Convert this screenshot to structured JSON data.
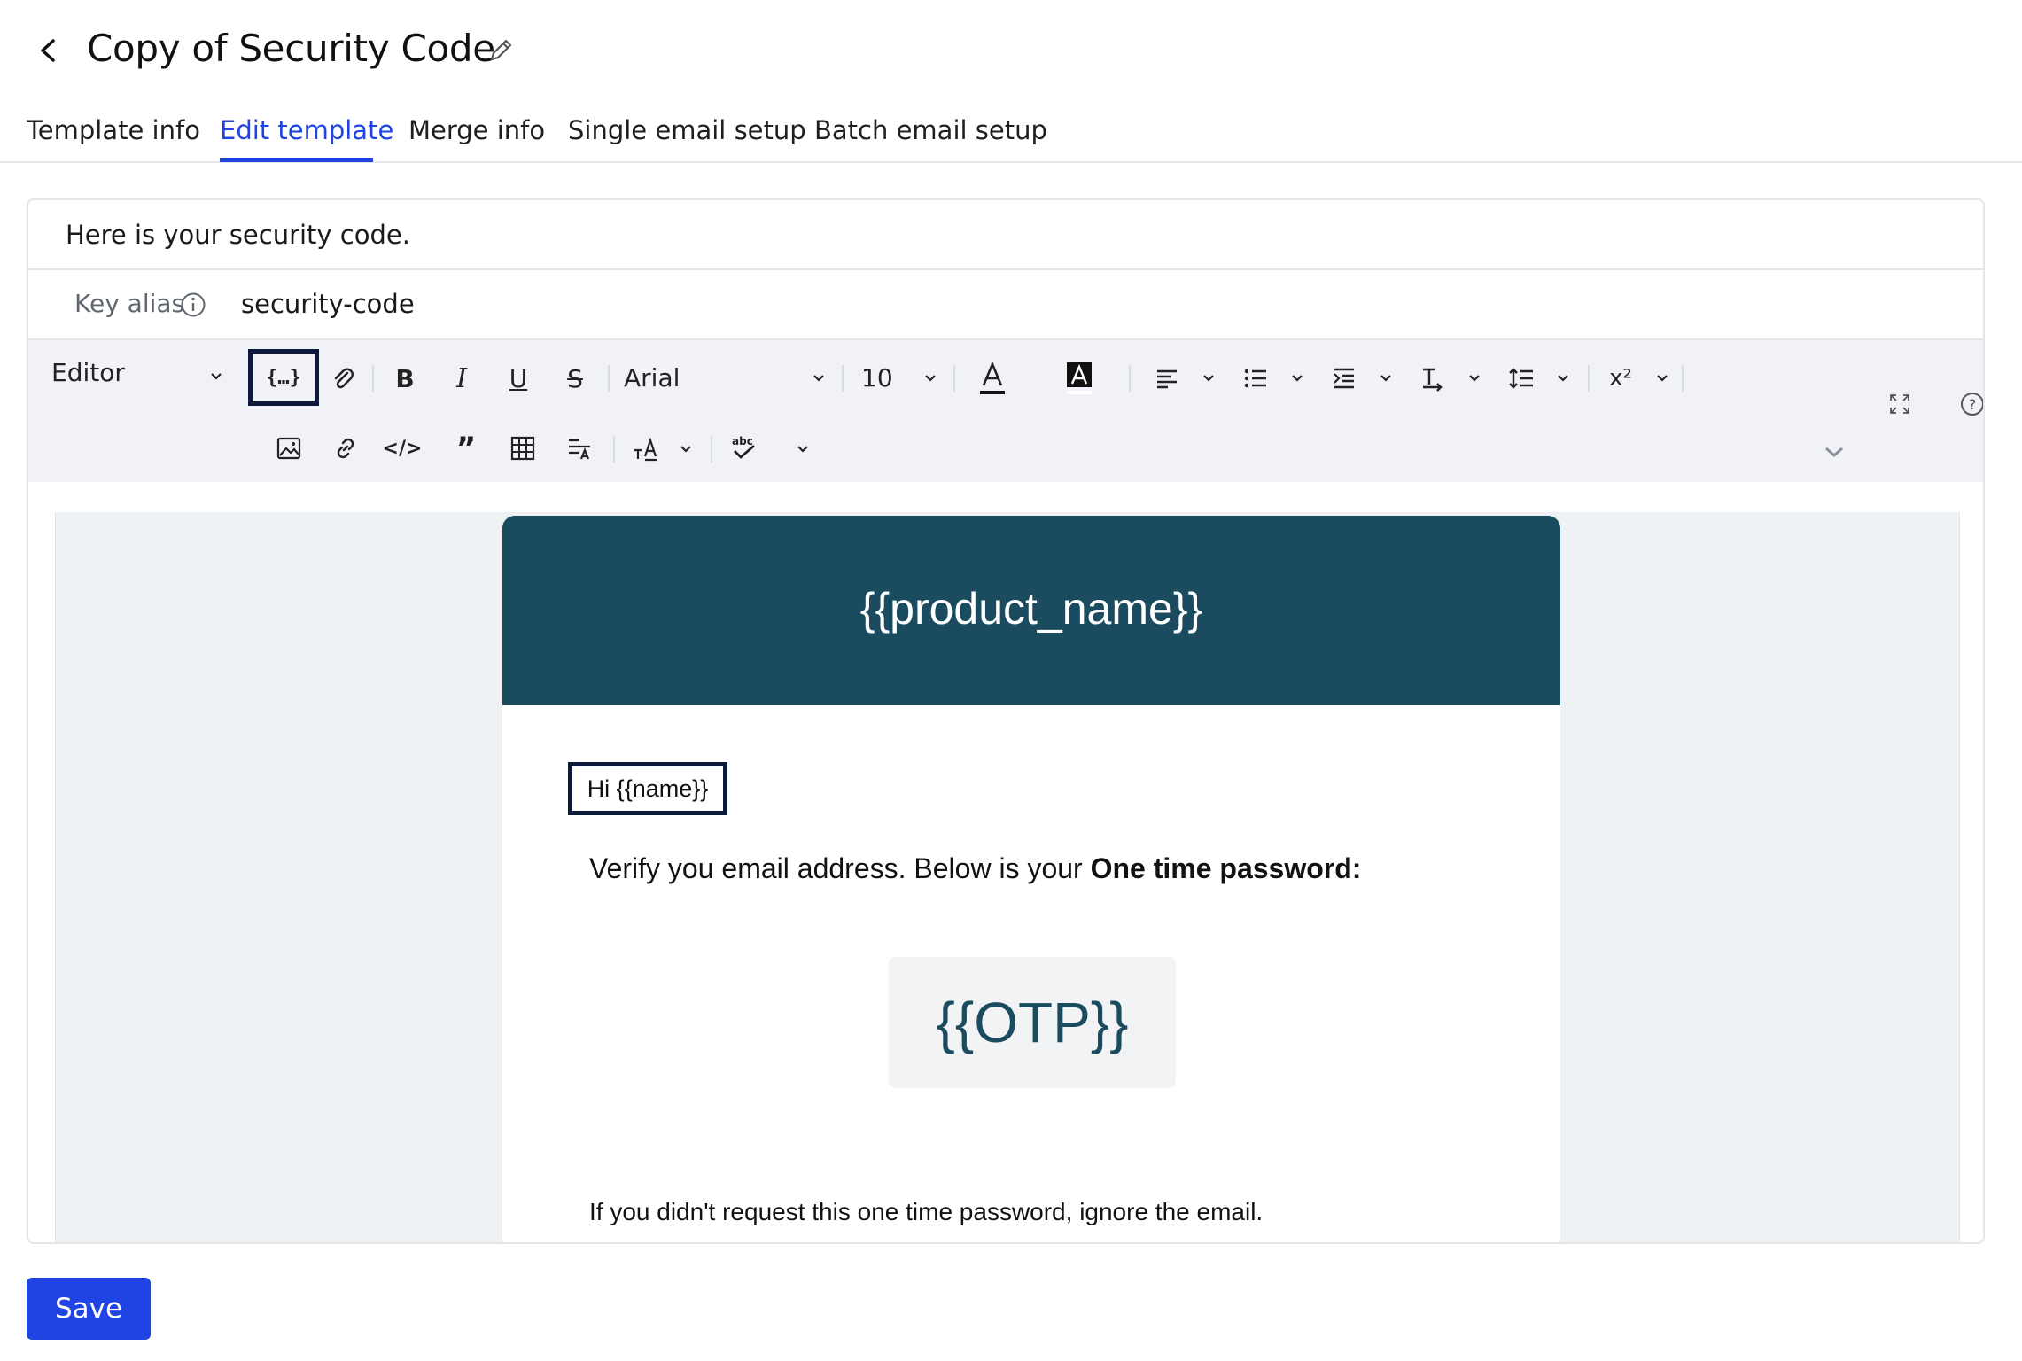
{
  "header": {
    "title": "Copy of Security Code"
  },
  "tabs": [
    {
      "label": "Template info",
      "active": false
    },
    {
      "label": "Edit template",
      "active": true
    },
    {
      "label": "Merge info",
      "active": false
    },
    {
      "label": "Single email setup",
      "active": false
    },
    {
      "label": "Batch email setup",
      "active": false
    }
  ],
  "form": {
    "subject": "Here is your security code.",
    "key_alias_label": "Key alias",
    "key_alias_value": "security-code"
  },
  "toolbar": {
    "mode_label": "Editor",
    "font_family": "Arial",
    "font_size": "10"
  },
  "email": {
    "header_text": "{{product_name}}",
    "greeting": "Hi {{name}}",
    "verify_text": "Verify you email address. Below is your ",
    "verify_bold": "One time password:",
    "otp": "{{OTP}}",
    "footer_text": "If you didn't request this one time password, ignore the email."
  },
  "actions": {
    "save_label": "Save"
  },
  "colors": {
    "accent": "#1f44e3",
    "email_header": "#1b4b5f",
    "toolbar_bg": "#f0f2f7",
    "canvas_bg": "#eff2f4"
  }
}
